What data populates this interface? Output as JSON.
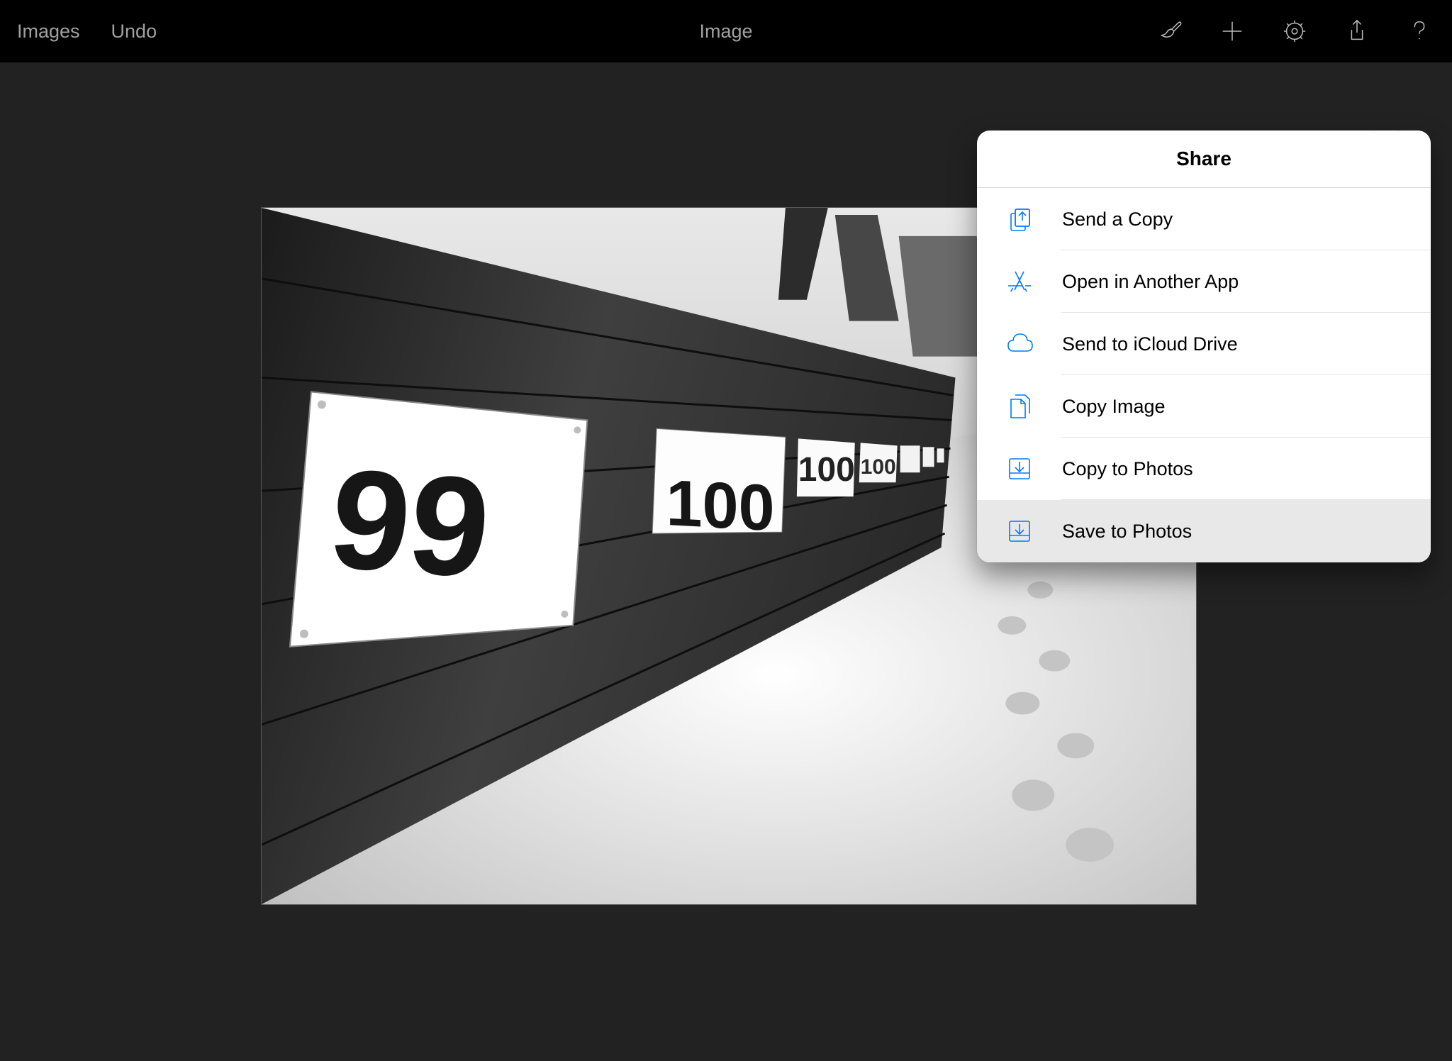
{
  "toolbar": {
    "back_label": "Images",
    "undo_label": "Undo",
    "title": "Image"
  },
  "popover": {
    "title": "Share",
    "items": [
      {
        "label": "Send a Copy",
        "icon": "share-sheet-icon",
        "selected": false
      },
      {
        "label": "Open in Another App",
        "icon": "appstore-icon",
        "selected": false
      },
      {
        "label": "Send to iCloud Drive",
        "icon": "cloud-icon",
        "selected": false
      },
      {
        "label": "Copy Image",
        "icon": "docs-icon",
        "selected": false
      },
      {
        "label": "Copy to Photos",
        "icon": "download-tray-icon",
        "selected": false
      },
      {
        "label": "Save to Photos",
        "icon": "download-tray-icon",
        "selected": true
      }
    ]
  },
  "image": {
    "signs": [
      "99",
      "100",
      "100",
      "100"
    ]
  }
}
